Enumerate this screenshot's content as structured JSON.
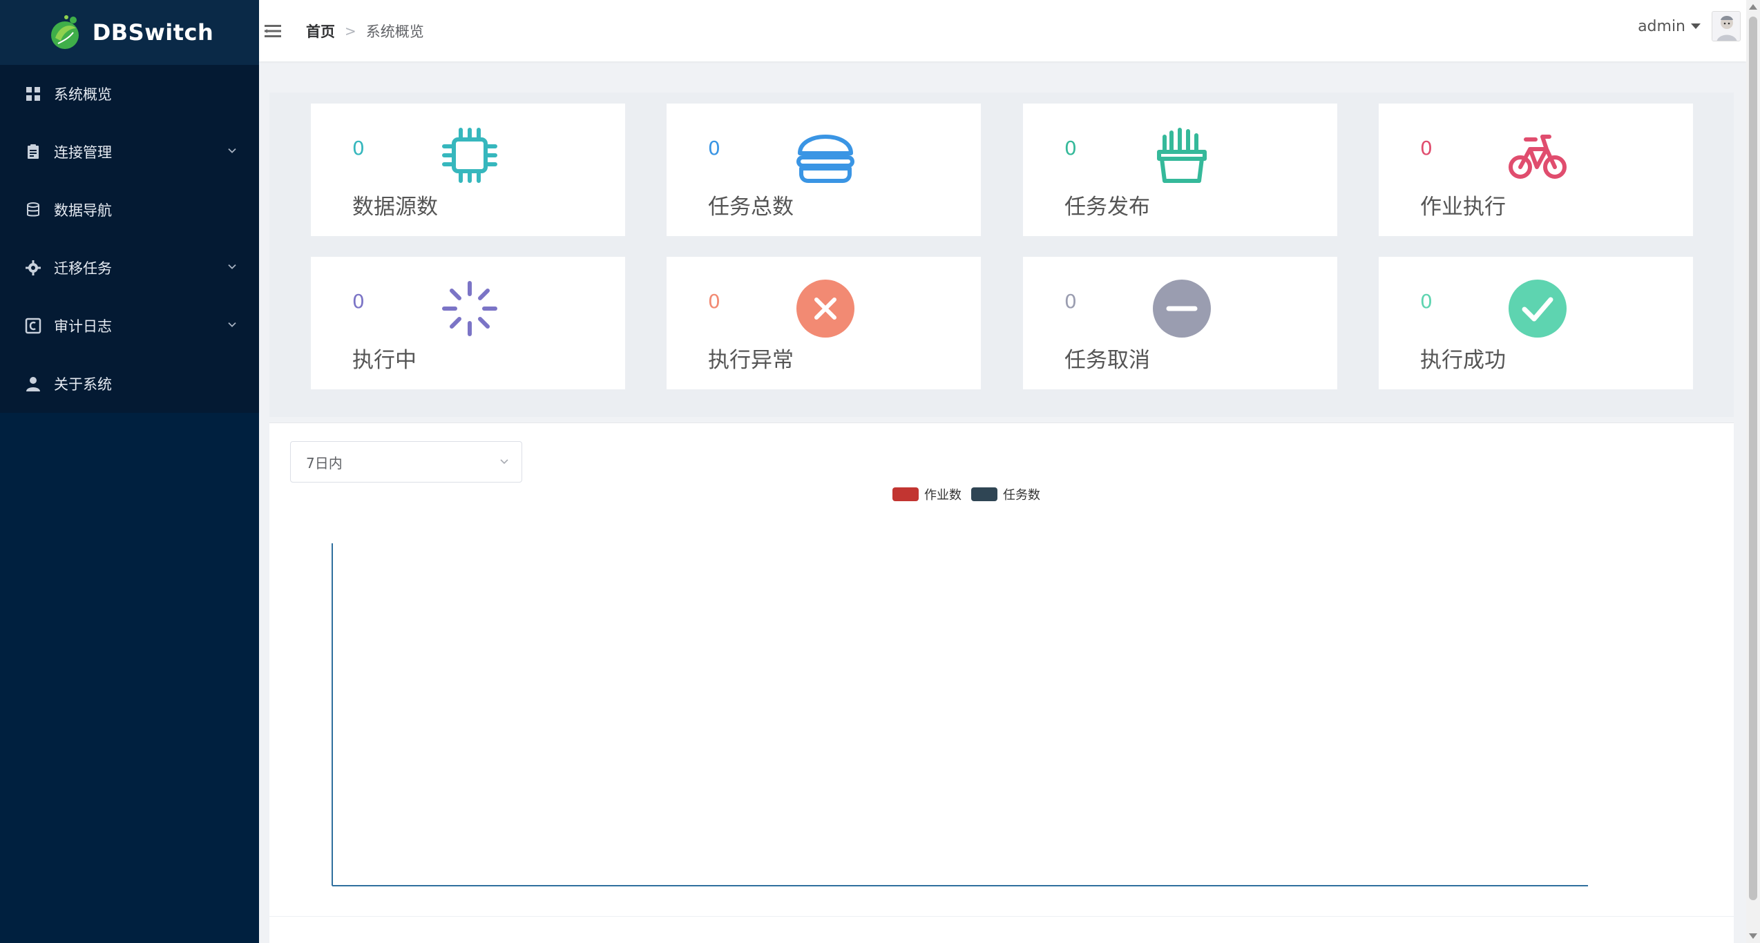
{
  "app": {
    "name": "DBSwitch"
  },
  "sidebar": {
    "items": [
      {
        "label": "系统概览",
        "icon": "grid-icon",
        "has_children": false
      },
      {
        "label": "连接管理",
        "icon": "clipboard-icon",
        "has_children": true
      },
      {
        "label": "数据导航",
        "icon": "database-icon",
        "has_children": false
      },
      {
        "label": "迁移任务",
        "icon": "gear-icon",
        "has_children": true
      },
      {
        "label": "审计日志",
        "icon": "log-icon",
        "has_children": true
      },
      {
        "label": "关于系统",
        "icon": "user-icon",
        "has_children": false
      }
    ]
  },
  "header": {
    "breadcrumb": {
      "home": "首页",
      "current": "系统概览"
    },
    "user": {
      "name": "admin"
    }
  },
  "stats": [
    {
      "value": "0",
      "label": "数据源数",
      "color": "#36b7bd",
      "icon": "chip-icon"
    },
    {
      "value": "0",
      "label": "任务总数",
      "color": "#3a95e4",
      "icon": "burger-icon"
    },
    {
      "value": "0",
      "label": "任务发布",
      "color": "#35b99a",
      "icon": "fries-icon"
    },
    {
      "value": "0",
      "label": "作业执行",
      "color": "#e04d6e",
      "icon": "bicycle-icon"
    },
    {
      "value": "0",
      "label": "执行中",
      "color": "#7b74c6",
      "icon": "loading-icon"
    },
    {
      "value": "0",
      "label": "执行异常",
      "color": "#f28a73",
      "icon": "error-circle-icon"
    },
    {
      "value": "0",
      "label": "任务取消",
      "color": "#9a9db0",
      "icon": "minus-circle-icon"
    },
    {
      "value": "0",
      "label": "执行成功",
      "color": "#5ed4b0",
      "icon": "check-circle-icon"
    }
  ],
  "filter": {
    "selected": "7日内"
  },
  "chart_data": {
    "type": "line",
    "legend_placement": "top-center",
    "series": [
      {
        "name": "作业数",
        "color": "#c23531",
        "values": []
      },
      {
        "name": "任务数",
        "color": "#2f4554",
        "values": []
      }
    ],
    "categories": [],
    "axis_color": "#2f6f9e"
  }
}
